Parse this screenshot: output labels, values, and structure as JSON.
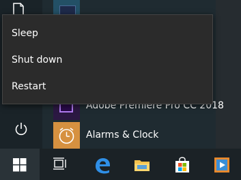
{
  "power_menu": {
    "items": [
      {
        "label": "Sleep"
      },
      {
        "label": "Shut down"
      },
      {
        "label": "Restart"
      }
    ]
  },
  "apps": [
    {
      "label": "Adobe Premiere Pro CC 2018",
      "icon": "premiere-icon",
      "tile_color": "#2b1842"
    },
    {
      "label": "Alarms & Clock",
      "icon": "alarm-clock-icon",
      "tile_color": "#d69140"
    }
  ],
  "taskbar": {
    "items": [
      "start-button",
      "task-view-icon",
      "edge-icon",
      "file-explorer-icon",
      "store-icon",
      "video-app-icon"
    ]
  },
  "colors": {
    "start_panel": "#1f2b31",
    "menu_background": "#2b2b2b",
    "taskbar": "#1b2226",
    "accent": "#0078d7"
  }
}
